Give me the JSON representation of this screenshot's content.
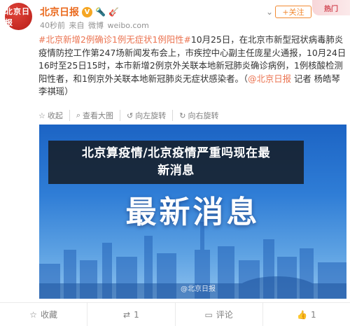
{
  "header": {
    "avatar_text": "北京日报",
    "user_name": "北京日报",
    "badge_v": "V",
    "badge_lv": "🔦",
    "badge_guitar": "🎸",
    "time": "40秒前",
    "source_prefix": "来自",
    "source": "微博",
    "source_site": "weibo.com",
    "follow_label": "+关注",
    "hot_tag": "热门"
  },
  "post": {
    "topic": "#北京新增2例确诊1例无症状1例阳性#",
    "body": "10月25日，在北京市新型冠状病毒肺炎疫情防控工作第247场新闻发布会上，市疾控中心副主任庞星火通报，10月24日16时至25日15时，本市新增2例京外关联本地新冠肺炎确诊病例，1例核酸检测阳性者，和1例京外关联本地新冠肺炎无症状感染者。（",
    "mention": "@北京日报",
    "tail": " 记者 杨皓琴 李祺瑶）"
  },
  "actions": [
    {
      "icon": "star-icon",
      "glyph": "☆",
      "label": "收起"
    },
    {
      "icon": "zoom-icon",
      "glyph": "⌕",
      "label": "查看大图"
    },
    {
      "icon": "rotate-left-icon",
      "glyph": "↺",
      "label": "向左旋转"
    },
    {
      "icon": "rotate-right-icon",
      "glyph": "↻",
      "label": "向右旋转"
    }
  ],
  "media": {
    "banner_text_line1": "北京算疫情/北京疫情严重吗现在最",
    "banner_text_line2": "新消息",
    "big_title": "最新消息",
    "watermark": "@北京日报"
  },
  "bottom_bar": [
    {
      "icon": "favorite-icon",
      "glyph": "☆",
      "label": "收藏"
    },
    {
      "icon": "repost-icon",
      "glyph": "⇄",
      "label": "1"
    },
    {
      "icon": "comment-icon",
      "glyph": "▭",
      "label": "评论"
    },
    {
      "icon": "like-icon",
      "glyph": "👍",
      "label": "1"
    }
  ],
  "colors": {
    "accent": "#eb7350",
    "name": "#ea6a1e",
    "sky_top": "#1c64c4",
    "sky_bottom": "#8cc0ee"
  }
}
